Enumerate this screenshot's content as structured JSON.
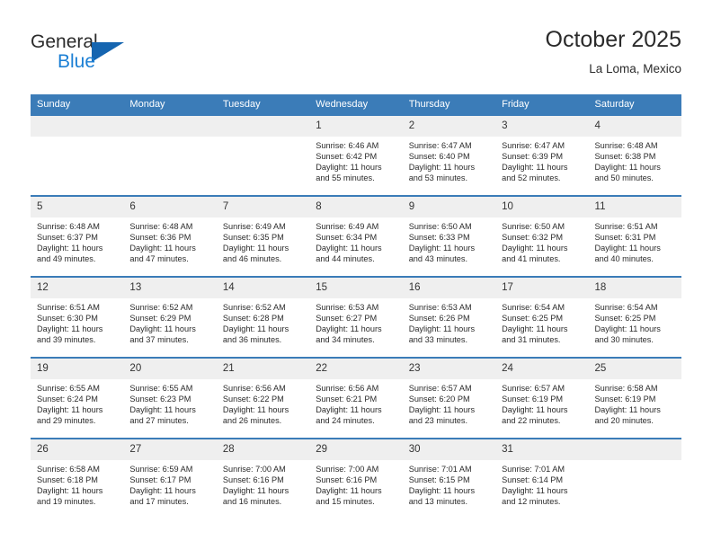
{
  "brand": {
    "name_part1": "General",
    "name_part2": "Blue",
    "triangle_color": "#1565b0",
    "blue_text_color": "#1b7fd4"
  },
  "header": {
    "title": "October 2025",
    "subtitle": "La Loma, Mexico"
  },
  "theme": {
    "header_blue": "#3b7cb8",
    "daynum_gray": "#efefef",
    "text_color": "#2b2b2b"
  },
  "weekday_headers": [
    "Sunday",
    "Monday",
    "Tuesday",
    "Wednesday",
    "Thursday",
    "Friday",
    "Saturday"
  ],
  "labels": {
    "sunrise_prefix": "Sunrise:",
    "sunset_prefix": "Sunset:",
    "daylight_prefix": "Daylight:"
  },
  "weeks": [
    [
      {
        "day": "",
        "sunrise": "",
        "sunset": "",
        "daylight_line1": "",
        "daylight_line2": ""
      },
      {
        "day": "",
        "sunrise": "",
        "sunset": "",
        "daylight_line1": "",
        "daylight_line2": ""
      },
      {
        "day": "",
        "sunrise": "",
        "sunset": "",
        "daylight_line1": "",
        "daylight_line2": ""
      },
      {
        "day": "1",
        "sunrise": "Sunrise: 6:46 AM",
        "sunset": "Sunset: 6:42 PM",
        "daylight_line1": "Daylight: 11 hours",
        "daylight_line2": "and 55 minutes."
      },
      {
        "day": "2",
        "sunrise": "Sunrise: 6:47 AM",
        "sunset": "Sunset: 6:40 PM",
        "daylight_line1": "Daylight: 11 hours",
        "daylight_line2": "and 53 minutes."
      },
      {
        "day": "3",
        "sunrise": "Sunrise: 6:47 AM",
        "sunset": "Sunset: 6:39 PM",
        "daylight_line1": "Daylight: 11 hours",
        "daylight_line2": "and 52 minutes."
      },
      {
        "day": "4",
        "sunrise": "Sunrise: 6:48 AM",
        "sunset": "Sunset: 6:38 PM",
        "daylight_line1": "Daylight: 11 hours",
        "daylight_line2": "and 50 minutes."
      }
    ],
    [
      {
        "day": "5",
        "sunrise": "Sunrise: 6:48 AM",
        "sunset": "Sunset: 6:37 PM",
        "daylight_line1": "Daylight: 11 hours",
        "daylight_line2": "and 49 minutes."
      },
      {
        "day": "6",
        "sunrise": "Sunrise: 6:48 AM",
        "sunset": "Sunset: 6:36 PM",
        "daylight_line1": "Daylight: 11 hours",
        "daylight_line2": "and 47 minutes."
      },
      {
        "day": "7",
        "sunrise": "Sunrise: 6:49 AM",
        "sunset": "Sunset: 6:35 PM",
        "daylight_line1": "Daylight: 11 hours",
        "daylight_line2": "and 46 minutes."
      },
      {
        "day": "8",
        "sunrise": "Sunrise: 6:49 AM",
        "sunset": "Sunset: 6:34 PM",
        "daylight_line1": "Daylight: 11 hours",
        "daylight_line2": "and 44 minutes."
      },
      {
        "day": "9",
        "sunrise": "Sunrise: 6:50 AM",
        "sunset": "Sunset: 6:33 PM",
        "daylight_line1": "Daylight: 11 hours",
        "daylight_line2": "and 43 minutes."
      },
      {
        "day": "10",
        "sunrise": "Sunrise: 6:50 AM",
        "sunset": "Sunset: 6:32 PM",
        "daylight_line1": "Daylight: 11 hours",
        "daylight_line2": "and 41 minutes."
      },
      {
        "day": "11",
        "sunrise": "Sunrise: 6:51 AM",
        "sunset": "Sunset: 6:31 PM",
        "daylight_line1": "Daylight: 11 hours",
        "daylight_line2": "and 40 minutes."
      }
    ],
    [
      {
        "day": "12",
        "sunrise": "Sunrise: 6:51 AM",
        "sunset": "Sunset: 6:30 PM",
        "daylight_line1": "Daylight: 11 hours",
        "daylight_line2": "and 39 minutes."
      },
      {
        "day": "13",
        "sunrise": "Sunrise: 6:52 AM",
        "sunset": "Sunset: 6:29 PM",
        "daylight_line1": "Daylight: 11 hours",
        "daylight_line2": "and 37 minutes."
      },
      {
        "day": "14",
        "sunrise": "Sunrise: 6:52 AM",
        "sunset": "Sunset: 6:28 PM",
        "daylight_line1": "Daylight: 11 hours",
        "daylight_line2": "and 36 minutes."
      },
      {
        "day": "15",
        "sunrise": "Sunrise: 6:53 AM",
        "sunset": "Sunset: 6:27 PM",
        "daylight_line1": "Daylight: 11 hours",
        "daylight_line2": "and 34 minutes."
      },
      {
        "day": "16",
        "sunrise": "Sunrise: 6:53 AM",
        "sunset": "Sunset: 6:26 PM",
        "daylight_line1": "Daylight: 11 hours",
        "daylight_line2": "and 33 minutes."
      },
      {
        "day": "17",
        "sunrise": "Sunrise: 6:54 AM",
        "sunset": "Sunset: 6:25 PM",
        "daylight_line1": "Daylight: 11 hours",
        "daylight_line2": "and 31 minutes."
      },
      {
        "day": "18",
        "sunrise": "Sunrise: 6:54 AM",
        "sunset": "Sunset: 6:25 PM",
        "daylight_line1": "Daylight: 11 hours",
        "daylight_line2": "and 30 minutes."
      }
    ],
    [
      {
        "day": "19",
        "sunrise": "Sunrise: 6:55 AM",
        "sunset": "Sunset: 6:24 PM",
        "daylight_line1": "Daylight: 11 hours",
        "daylight_line2": "and 29 minutes."
      },
      {
        "day": "20",
        "sunrise": "Sunrise: 6:55 AM",
        "sunset": "Sunset: 6:23 PM",
        "daylight_line1": "Daylight: 11 hours",
        "daylight_line2": "and 27 minutes."
      },
      {
        "day": "21",
        "sunrise": "Sunrise: 6:56 AM",
        "sunset": "Sunset: 6:22 PM",
        "daylight_line1": "Daylight: 11 hours",
        "daylight_line2": "and 26 minutes."
      },
      {
        "day": "22",
        "sunrise": "Sunrise: 6:56 AM",
        "sunset": "Sunset: 6:21 PM",
        "daylight_line1": "Daylight: 11 hours",
        "daylight_line2": "and 24 minutes."
      },
      {
        "day": "23",
        "sunrise": "Sunrise: 6:57 AM",
        "sunset": "Sunset: 6:20 PM",
        "daylight_line1": "Daylight: 11 hours",
        "daylight_line2": "and 23 minutes."
      },
      {
        "day": "24",
        "sunrise": "Sunrise: 6:57 AM",
        "sunset": "Sunset: 6:19 PM",
        "daylight_line1": "Daylight: 11 hours",
        "daylight_line2": "and 22 minutes."
      },
      {
        "day": "25",
        "sunrise": "Sunrise: 6:58 AM",
        "sunset": "Sunset: 6:19 PM",
        "daylight_line1": "Daylight: 11 hours",
        "daylight_line2": "and 20 minutes."
      }
    ],
    [
      {
        "day": "26",
        "sunrise": "Sunrise: 6:58 AM",
        "sunset": "Sunset: 6:18 PM",
        "daylight_line1": "Daylight: 11 hours",
        "daylight_line2": "and 19 minutes."
      },
      {
        "day": "27",
        "sunrise": "Sunrise: 6:59 AM",
        "sunset": "Sunset: 6:17 PM",
        "daylight_line1": "Daylight: 11 hours",
        "daylight_line2": "and 17 minutes."
      },
      {
        "day": "28",
        "sunrise": "Sunrise: 7:00 AM",
        "sunset": "Sunset: 6:16 PM",
        "daylight_line1": "Daylight: 11 hours",
        "daylight_line2": "and 16 minutes."
      },
      {
        "day": "29",
        "sunrise": "Sunrise: 7:00 AM",
        "sunset": "Sunset: 6:16 PM",
        "daylight_line1": "Daylight: 11 hours",
        "daylight_line2": "and 15 minutes."
      },
      {
        "day": "30",
        "sunrise": "Sunrise: 7:01 AM",
        "sunset": "Sunset: 6:15 PM",
        "daylight_line1": "Daylight: 11 hours",
        "daylight_line2": "and 13 minutes."
      },
      {
        "day": "31",
        "sunrise": "Sunrise: 7:01 AM",
        "sunset": "Sunset: 6:14 PM",
        "daylight_line1": "Daylight: 11 hours",
        "daylight_line2": "and 12 minutes."
      },
      {
        "day": "",
        "sunrise": "",
        "sunset": "",
        "daylight_line1": "",
        "daylight_line2": ""
      }
    ]
  ]
}
